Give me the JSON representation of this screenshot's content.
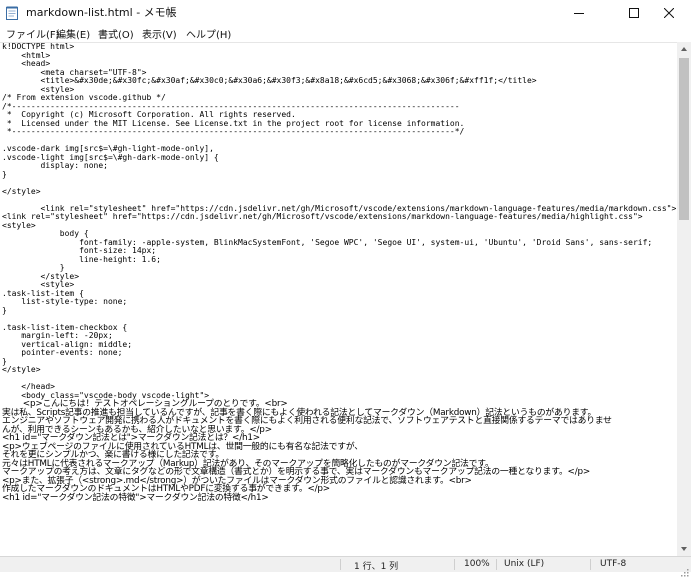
{
  "window": {
    "title": "markdown-list.html - メモ帳",
    "icon": "notepad-icon",
    "controls": {
      "minimize": "minimize-icon",
      "maximize": "maximize-icon",
      "close": "close-icon"
    }
  },
  "menu": {
    "items": [
      "ファイル(F)",
      "編集(E)",
      "書式(O)",
      "表示(V)",
      "ヘルプ(H)"
    ]
  },
  "editor": {
    "lines": [
      "k!DOCTYPE html>",
      "    <html>",
      "    <head>",
      "        <meta charset=\"UTF-8\">",
      "        <title>&#x30de;&#x30fc;&#x30af;&#x30c0;&#x30a6;&#x30f3;&#x8a18;&#x6cd5;&#x3068;&#x306f;&#xff1f;</title>",
      "        <style>",
      "/* From extension vscode.github */",
      "/*---------------------------------------------------------------------------------------------",
      " *  Copyright (c) Microsoft Corporation. All rights reserved.",
      " *  Licensed under the MIT License. See License.txt in the project root for license information.",
      " *--------------------------------------------------------------------------------------------*/",
      "",
      ".vscode-dark img[src$=\\#gh-light-mode-only],",
      ".vscode-light img[src$=\\#gh-dark-mode-only] {",
      "        display: none;",
      "}",
      "",
      "</style>",
      "",
      "        <link rel=\"stylesheet\" href=\"https://cdn.jsdelivr.net/gh/Microsoft/vscode/extensions/markdown-language-features/media/markdown.css\">",
      "<link rel=\"stylesheet\" href=\"https://cdn.jsdelivr.net/gh/Microsoft/vscode/extensions/markdown-language-features/media/highlight.css\">",
      "<style>",
      "            body {",
      "                font-family: -apple-system, BlinkMacSystemFont, 'Segoe WPC', 'Segoe UI', system-ui, 'Ubuntu', 'Droid Sans', sans-serif;",
      "                font-size: 14px;",
      "                line-height: 1.6;",
      "            }",
      "        </style>",
      "        <style>",
      ".task-list-item {",
      "    list-style-type: none;",
      "}",
      "",
      ".task-list-item-checkbox {",
      "    margin-left: -20px;",
      "    vertical-align: middle;",
      "    pointer-events: none;",
      "}",
      "</style>",
      "",
      "    </head>",
      "    <body class=\"vscode-body vscode-light\">",
      "        <p>こんにちは！テストオペレーショングループのとりです。<br>",
      "実は私、Scripts記事の推進も担当しているんですが、記事を書く際にもよく使われる記法としてマークダウン（Markdown）記法というものがあります。",
      "エンジニアやソフトウェア開発に携わる人がドキュメントを書く際にもよく利用される便利な記法で、ソフトウェアテストと直接関係するテーマではありませ",
      "んが、利用できるシーンもあるかも、紹介したいなと思います。</p>",
      "<h1 id=\"マークダウン記法とは\">マークダウン記法とは？</h1>",
      "<p>ウェブページのファイルに使用されているHTMLは、世間一般的にも有名な記法ですが、",
      "それを更にシンプルかつ、楽に書ける様にした記法です。",
      "元々はHTMLに代表されるマークアップ（Markup）記法があり、そのマークアップを簡略化したものがマークダウン記法です。",
      "マークアップの考え方は、文章にタグなどの形で文章構造（書式とか）を明示する事で、実はマークダウンもマークアップ記法の一種となります。</p>",
      "<p>また、拡張子（<strong>.md</strong>）がついたファイルはマークダウン形式のファイルと認識されます。<br>",
      "作成したマークダウンのドキュメントはHTMLやPDFに変換する事ができます。</p>",
      "<h1 id=\"マークダウン記法の特徴\">マークダウン記法の特徴</h1>"
    ]
  },
  "status": {
    "position": "1 行、1 列",
    "zoom": "100%",
    "line_ending": "Unix (LF)",
    "encoding": "UTF-8"
  }
}
